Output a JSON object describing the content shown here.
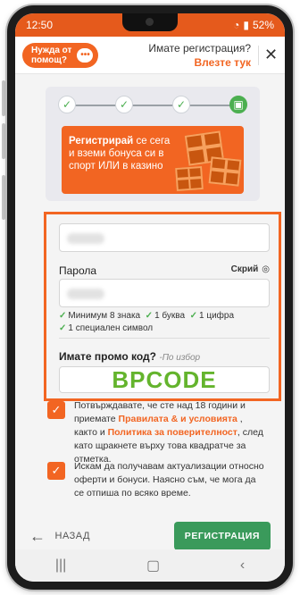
{
  "statusbar": {
    "time": "12:50",
    "battery": "52%"
  },
  "header": {
    "help_line1": "Нужда от",
    "help_line2": "помощ?",
    "have_account": "Имате регистрация?",
    "login_link": "Влезте тук",
    "close_icon": "close-icon"
  },
  "steps": {
    "count": 4,
    "current": 4
  },
  "banner": {
    "bold": "Регистрирай",
    "text": " се сега и вземи бонуса си в спорт ИЛИ в казино"
  },
  "form": {
    "password_label": "Парола",
    "show_label": "Скрий",
    "rule1": "Минимум 8 знака",
    "rule2": "1 буква",
    "rule3": "1 цифра",
    "rule4": "1 специален символ",
    "promo_label": "Имате промо код?",
    "promo_optional": "-По избор",
    "promo_code": "BPCODE"
  },
  "consents": {
    "c1_part1": "Потвърждавате, че сте над 18 години и приемате ",
    "c1_link1": "Правилата & и условията",
    "c1_part2": " , както и ",
    "c1_link2": "Политика за поверителност",
    "c1_part3": ", след като щракнете върху това квадратче за отметка.",
    "c2": "Искам да получавам актуализации относно оферти и бонуси. Наясно съм, че мога да се отпиша по всяко време."
  },
  "footer": {
    "back_label": "НАЗАД",
    "register_label": "РЕГИСТРАЦИЯ"
  },
  "colors": {
    "brand_orange": "#f26522",
    "success_green": "#4caf50",
    "promo_code_green": "#64b42d",
    "button_green": "#3a9a5b"
  }
}
